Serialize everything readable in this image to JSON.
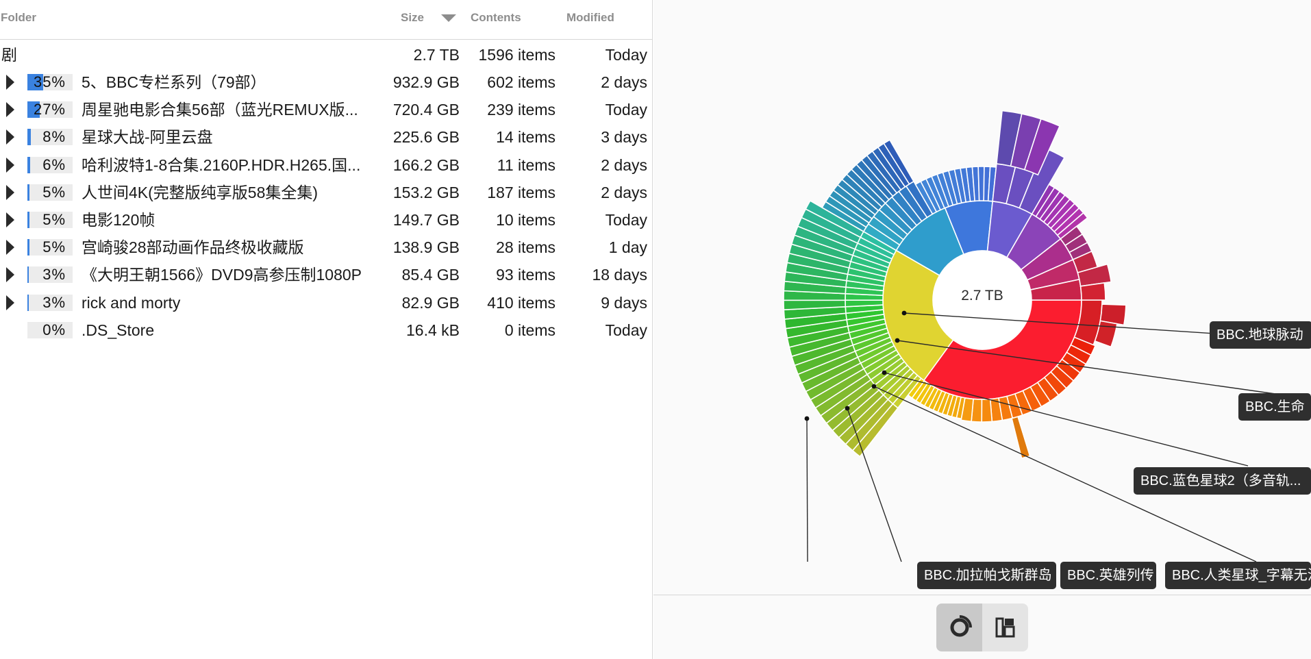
{
  "columns": {
    "folder": "Folder",
    "size": "Size",
    "contents": "Contents",
    "modified": "Modified"
  },
  "root": {
    "name": "剧",
    "size": "2.7 TB",
    "contents": "1596 items",
    "modified": "Today"
  },
  "rows": [
    {
      "percent": "35%",
      "fraction": 0.35,
      "name": "5、BBC专栏系列（79部）",
      "size": "932.9 GB",
      "contents": "602 items",
      "modified": "2 days",
      "expandable": true
    },
    {
      "percent": "27%",
      "fraction": 0.27,
      "name": "周星驰电影合集56部（蓝光REMUX版...",
      "size": "720.4 GB",
      "contents": "239 items",
      "modified": "Today",
      "expandable": true
    },
    {
      "percent": "8%",
      "fraction": 0.08,
      "name": "星球大战-阿里云盘",
      "size": "225.6 GB",
      "contents": "14 items",
      "modified": "3 days",
      "expandable": true
    },
    {
      "percent": "6%",
      "fraction": 0.06,
      "name": "哈利波特1-8合集.2160P.HDR.H265.国...",
      "size": "166.2 GB",
      "contents": "11 items",
      "modified": "2 days",
      "expandable": true
    },
    {
      "percent": "5%",
      "fraction": 0.05,
      "name": "人世间4K(完整版纯享版58集全集)",
      "size": "153.2 GB",
      "contents": "187 items",
      "modified": "2 days",
      "expandable": true
    },
    {
      "percent": "5%",
      "fraction": 0.05,
      "name": "电影120帧",
      "size": "149.7 GB",
      "contents": "10 items",
      "modified": "Today",
      "expandable": true
    },
    {
      "percent": "5%",
      "fraction": 0.05,
      "name": "宫崎骏28部动画作品终极收藏版",
      "size": "138.9 GB",
      "contents": "28 items",
      "modified": "1 day",
      "expandable": true
    },
    {
      "percent": "3%",
      "fraction": 0.03,
      "name": "《大明王朝1566》DVD9高参压制1080P",
      "size": "85.4 GB",
      "contents": "93 items",
      "modified": "18 days",
      "expandable": true
    },
    {
      "percent": "3%",
      "fraction": 0.03,
      "name": "rick and morty",
      "size": "82.9 GB",
      "contents": "410 items",
      "modified": "9 days",
      "expandable": true
    },
    {
      "percent": "0%",
      "fraction": 0.0,
      "name": ".DS_Store",
      "size": "16.4 kB",
      "contents": "0 items",
      "modified": "Today",
      "expandable": false
    }
  ],
  "chart": {
    "center_label": "2.7 TB",
    "labels": [
      "BBC.地球脉动",
      "BBC.生命",
      "BBC.蓝色星球2（多音轨...",
      "BBC.加拉帕戈斯群岛",
      "BBC.英雄列传",
      "BBC.人类星球_字幕无法"
    ]
  },
  "toolbar": {
    "active_view": "ring-chart"
  },
  "colors": {
    "accent": "#3a82e0",
    "label_bg": "#2f2f2f"
  }
}
